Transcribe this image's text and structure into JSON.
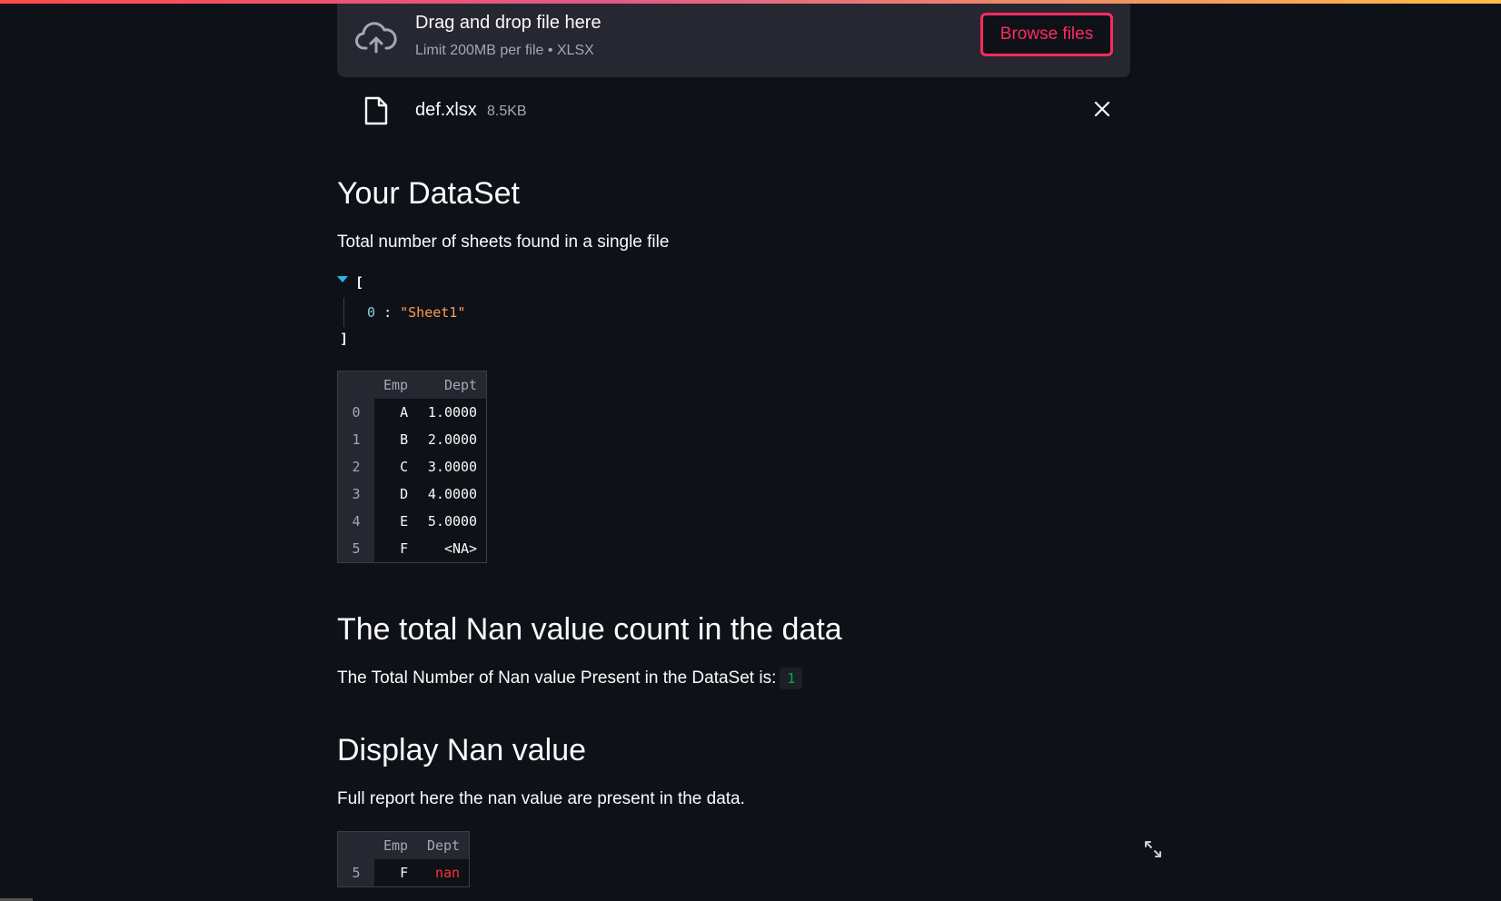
{
  "uploader": {
    "title": "Drag and drop file here",
    "limit": "Limit 200MB per file • XLSX",
    "browse_label": "Browse files",
    "icon": "cloud-upload-icon"
  },
  "file": {
    "name": "def.xlsx",
    "size": "8.5KB",
    "icon": "file-icon"
  },
  "section1": {
    "heading": "Your DataSet",
    "text": "Total number of sheets found in a single file",
    "json": {
      "open": "[",
      "close": "]",
      "key": "0",
      "sep": ":",
      "value": "\"Sheet1\""
    }
  },
  "dataset_table": {
    "columns": [
      "",
      "Emp",
      "Dept"
    ],
    "rows": [
      {
        "index": "0",
        "emp": "A",
        "dept": "1.0000"
      },
      {
        "index": "1",
        "emp": "B",
        "dept": "2.0000"
      },
      {
        "index": "2",
        "emp": "C",
        "dept": "3.0000"
      },
      {
        "index": "3",
        "emp": "D",
        "dept": "4.0000"
      },
      {
        "index": "4",
        "emp": "E",
        "dept": "5.0000"
      },
      {
        "index": "5",
        "emp": "F",
        "dept": "<NA>"
      }
    ]
  },
  "section2": {
    "heading": "The total Nan value count in the data",
    "text": "The Total Number of Nan value Present in the DataSet is:",
    "count": "1"
  },
  "section3": {
    "heading": "Display Nan value",
    "text": "Full report here the nan value are present in the data."
  },
  "nan_table": {
    "columns": [
      "",
      "Emp",
      "Dept"
    ],
    "rows": [
      {
        "index": "5",
        "emp": "F",
        "dept": "nan"
      }
    ]
  },
  "colors": {
    "background": "#0e1117",
    "accent": "#ff2b5e",
    "nan": "#ff3333",
    "code_green": "#09ab3b"
  }
}
